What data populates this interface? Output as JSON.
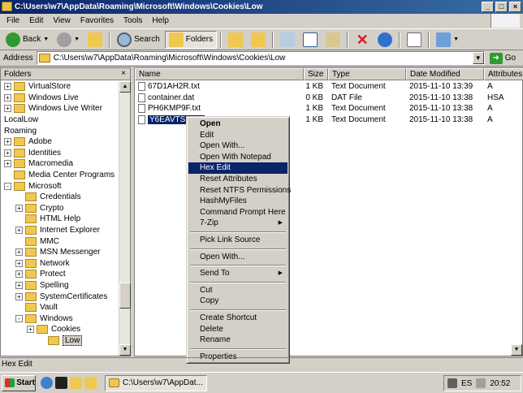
{
  "window": {
    "title": "C:\\Users\\w7\\AppData\\Roaming\\Microsoft\\Windows\\Cookies\\Low"
  },
  "menu": {
    "items": [
      "File",
      "Edit",
      "View",
      "Favorites",
      "Tools",
      "Help"
    ]
  },
  "toolbar": {
    "back_label": "Back",
    "search_label": "Search",
    "folders_label": "Folders"
  },
  "address": {
    "label": "Address",
    "value": "C:\\Users\\w7\\AppData\\Roaming\\Microsoft\\Windows\\Cookies\\Low",
    "go_label": "Go"
  },
  "folders_pane": {
    "title": "Folders",
    "tree": [
      {
        "label": "VirtualStore",
        "expander": "+",
        "indent": 0
      },
      {
        "label": "Windows Live",
        "expander": "+",
        "indent": 0
      },
      {
        "label": "Windows Live Writer",
        "expander": "+",
        "indent": 0
      },
      {
        "label": "LocalLow",
        "expander": "",
        "indent": -1
      },
      {
        "label": "Roaming",
        "expander": "",
        "indent": -1
      },
      {
        "label": "Adobe",
        "expander": "+",
        "indent": 0
      },
      {
        "label": "Identities",
        "expander": "+",
        "indent": 0
      },
      {
        "label": "Macromedia",
        "expander": "+",
        "indent": 0
      },
      {
        "label": "Media Center Programs",
        "expander": "",
        "indent": 0
      },
      {
        "label": "Microsoft",
        "expander": "-",
        "indent": 0
      },
      {
        "label": "Credentials",
        "expander": "",
        "indent": 1
      },
      {
        "label": "Crypto",
        "expander": "+",
        "indent": 1
      },
      {
        "label": "HTML Help",
        "expander": "",
        "indent": 1
      },
      {
        "label": "Internet Explorer",
        "expander": "+",
        "indent": 1
      },
      {
        "label": "MMC",
        "expander": "",
        "indent": 1
      },
      {
        "label": "MSN Messenger",
        "expander": "+",
        "indent": 1
      },
      {
        "label": "Network",
        "expander": "+",
        "indent": 1
      },
      {
        "label": "Protect",
        "expander": "+",
        "indent": 1
      },
      {
        "label": "Spelling",
        "expander": "+",
        "indent": 1
      },
      {
        "label": "SystemCertificates",
        "expander": "+",
        "indent": 1
      },
      {
        "label": "Vault",
        "expander": "",
        "indent": 1
      },
      {
        "label": "Windows",
        "expander": "-",
        "indent": 1
      },
      {
        "label": "Cookies",
        "expander": "+",
        "indent": 2
      },
      {
        "label": "Low",
        "expander": "",
        "indent": 3,
        "selected": true
      }
    ]
  },
  "files_pane": {
    "columns": [
      "Name",
      "Size",
      "Type",
      "Date Modified",
      "Attributes"
    ],
    "rows": [
      {
        "name": "67D1AH2R.txt",
        "size": "1 KB",
        "type": "Text Document",
        "date": "2015-11-10 13:39",
        "attr": "A"
      },
      {
        "name": "container.dat",
        "size": "0 KB",
        "type": "DAT File",
        "date": "2015-11-10 13:38",
        "attr": "HSA"
      },
      {
        "name": "PH6KMP9F.txt",
        "size": "1 KB",
        "type": "Text Document",
        "date": "2015-11-10 13:38",
        "attr": "A"
      },
      {
        "name": "Y6EAVTSM.txt",
        "size": "1 KB",
        "type": "Text Document",
        "date": "2015-11-10 13:38",
        "attr": "A",
        "selected": true
      }
    ]
  },
  "context_menu": {
    "items": [
      {
        "label": "Open",
        "bold": true
      },
      {
        "label": "Edit"
      },
      {
        "label": "Open With..."
      },
      {
        "label": "Open With Notepad"
      },
      {
        "label": "Hex Edit",
        "highlighted": true
      },
      {
        "label": "Reset Attributes"
      },
      {
        "label": "Reset NTFS Permissions"
      },
      {
        "label": "HashMyFiles"
      },
      {
        "label": "Command Prompt Here"
      },
      {
        "label": "7-Zip",
        "submenu": true
      },
      {
        "separator": true
      },
      {
        "label": "Pick Link Source"
      },
      {
        "separator": true
      },
      {
        "label": "Open With..."
      },
      {
        "separator": true
      },
      {
        "label": "Send To",
        "submenu": true
      },
      {
        "separator": true
      },
      {
        "label": "Cut"
      },
      {
        "label": "Copy"
      },
      {
        "separator": true
      },
      {
        "label": "Create Shortcut"
      },
      {
        "label": "Delete"
      },
      {
        "label": "Rename"
      },
      {
        "separator": true
      },
      {
        "label": "Properties"
      }
    ]
  },
  "status_bar": {
    "text": "Hex Edit"
  },
  "taskbar": {
    "start_label": "Start",
    "task_label": "C:\\Users\\w7\\AppDat...",
    "language": "ES",
    "clock": "20:52"
  },
  "colors": {
    "title_bg": "#0a246a",
    "selection": "#0a246a",
    "face": "#d4d0c8"
  }
}
